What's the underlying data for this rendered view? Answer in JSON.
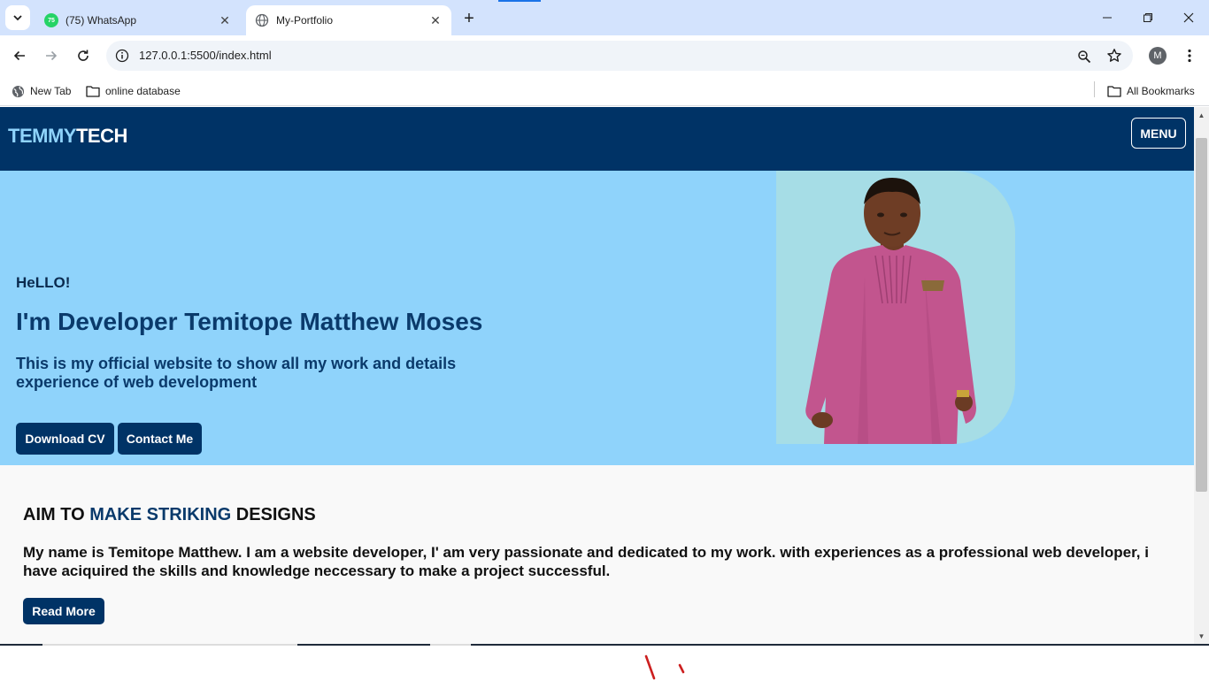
{
  "browser": {
    "tabs": [
      {
        "title": "(75) WhatsApp",
        "badge": "75",
        "active": false
      },
      {
        "title": "My-Portfolio",
        "active": true
      }
    ],
    "new_tab_symbol": "+",
    "tab_close_symbol": "✕",
    "window_controls": [
      "minimize",
      "restore",
      "close"
    ],
    "address": "127.0.0.1:5500/index.html",
    "profile_initial": "M",
    "bookmarks": [
      {
        "label": "New Tab",
        "icon": "globe-icon"
      },
      {
        "label": "online database",
        "icon": "folder-icon"
      }
    ],
    "all_bookmarks": "All Bookmarks"
  },
  "site": {
    "logo_part1": "TEMMY",
    "logo_part2": "TECH",
    "menu_label": "MENU",
    "hero": {
      "greeting": "HeLLO!",
      "headline": "I'm Developer Temitope Matthew Moses",
      "subtitle": "This is my official website to show all my work and details experience of web development",
      "buttons": [
        "Download CV",
        "Contact Me"
      ]
    },
    "about": {
      "heading_start": "AIM TO ",
      "heading_highlight": "MAKE STRIKING",
      "heading_end": " DESIGNS",
      "body": "My name is Temitope Matthew. I am a website developer, I' am very passionate and dedicated to my work. with experiences as a professional web developer, i have aciquired the skills and knowledge neccessary to make a project successful.",
      "read_more": "Read More"
    }
  },
  "colors": {
    "navy": "#003366",
    "hero_bg": "#8fd3fb",
    "photo_bg": "#a6dde6",
    "logo_accent": "#8fd3fb",
    "chrome_tabstrip": "#d3e3fd"
  }
}
